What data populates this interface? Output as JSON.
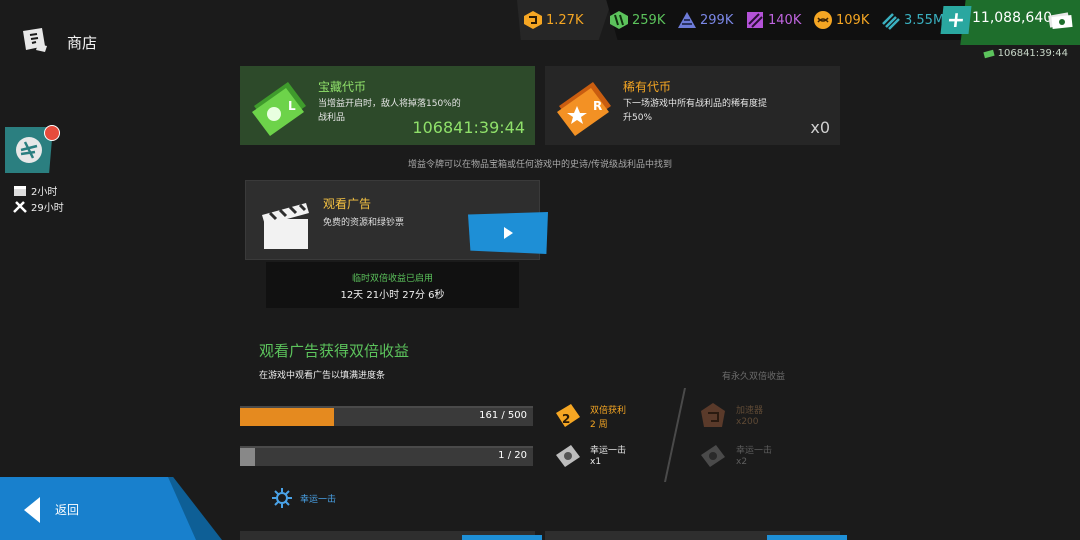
{
  "header": {
    "title": "商店"
  },
  "currencies": [
    {
      "name": "orange-token",
      "value": "1.27K",
      "color": "#f5a623"
    },
    {
      "name": "green-resource",
      "value": "259K",
      "color": "#5cc35c"
    },
    {
      "name": "blue-resource",
      "value": "299K",
      "color": "#6d7bd8"
    },
    {
      "name": "purple-resource",
      "value": "140K",
      "color": "#b452d8"
    },
    {
      "name": "orange-resource",
      "value": "109K",
      "color": "#f5a623"
    },
    {
      "name": "teal-resource",
      "value": "3.55M",
      "color": "#3ab0c0"
    }
  ],
  "cash": {
    "value": "11,088,640"
  },
  "token_timer": "106841:39:44",
  "side_event": {
    "line1": "2小时",
    "line2": "29小时"
  },
  "cards": [
    {
      "title": "宝藏代币",
      "desc": "当增益开启时，敌人将掉落150%的战利品",
      "value": "106841:39:44"
    },
    {
      "title": "稀有代币",
      "desc": "下一场游戏中所有战利品的稀有度提升50%",
      "value": "x0"
    }
  ],
  "hint": "增益令牌可以在物品宝箱或任何游戏中的史诗/传说级战利品中找到",
  "ad": {
    "title": "观看广告",
    "desc": "免费的资源和绿钞票",
    "timer_label": "临时双倍收益已启用",
    "timer_value": "12天 21小时 27分 6秒"
  },
  "double": {
    "title": "观看广告获得双倍收益",
    "subtitle": "在游戏中观看广告以填满进度条",
    "permanent_label": "有永久双倍收益",
    "bars": [
      {
        "label": "161 / 500",
        "progress": 0.322,
        "color": "#e58a1f"
      },
      {
        "label": "1 / 20",
        "progress": 0.05,
        "color": "#888888"
      }
    ],
    "rewards": [
      {
        "name": "双倍获利",
        "value": "2 周"
      },
      {
        "name": "幸运一击",
        "value": "x1"
      }
    ],
    "perm_rewards": [
      {
        "name": "加速器",
        "value": "x200"
      },
      {
        "name": "幸运一击",
        "value": "x2"
      }
    ],
    "lucky_link": "幸运一击"
  },
  "back": {
    "label": "返回"
  }
}
